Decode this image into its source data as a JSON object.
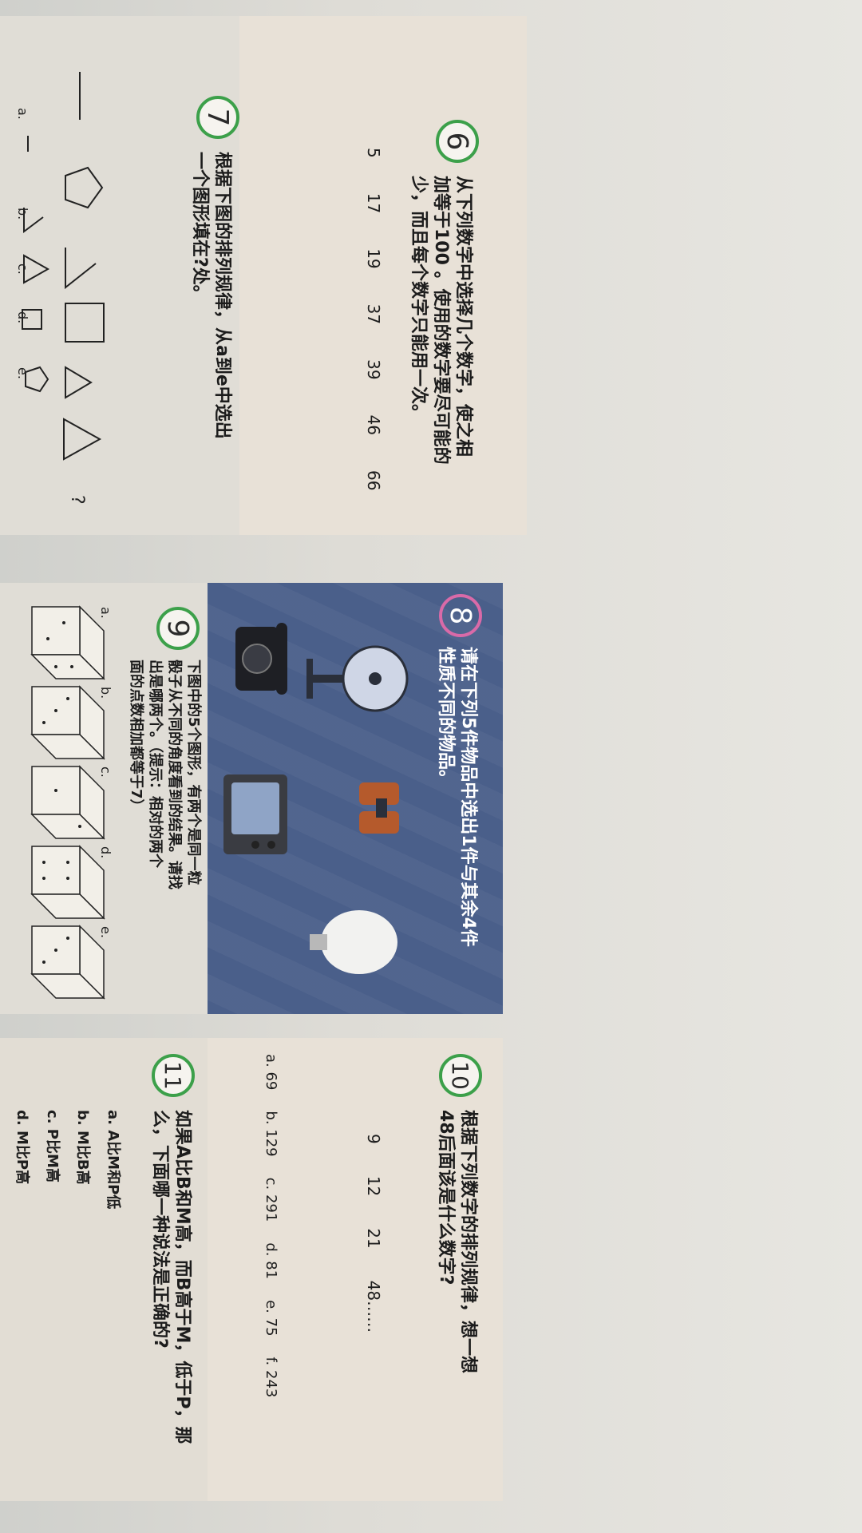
{
  "q6": {
    "num": "6",
    "text_line1": "从下列数字中选择几个数字，使之相",
    "text_line2": "加等于100 。使用的数字要尽可能的",
    "text_line3": "少，而且每个数字只能用一次。",
    "numbers": [
      "5",
      "17",
      "19",
      "37",
      "39",
      "46",
      "66"
    ]
  },
  "q7": {
    "num": "7",
    "text_line1": "根据下图的排列规律，从a到e中选出",
    "text_line2": "一个图形填在?处。",
    "question_mark": "?",
    "options": [
      "a.",
      "b.",
      "c.",
      "d.",
      "e."
    ]
  },
  "q8": {
    "num": "8",
    "text_line1": "请在下列5件物品中选出1件与其余4件",
    "text_line2": "性质不同的物品。"
  },
  "q9": {
    "num": "9",
    "text_line1": "下图中的5个图形，有两个是同一粒",
    "text_line2": "骰子从不同的角度看到的结果。请找",
    "text_line3": "出是哪两个。（提示：相对的两个",
    "text_line4": "面的点数相加都等于7）",
    "options": [
      "a.",
      "b.",
      "c.",
      "d.",
      "e."
    ]
  },
  "q10": {
    "num": "10",
    "text_line1": "根据下列数字的排列规律，想一想",
    "text_line2": "48后面该是什么数字?",
    "sequence": [
      "9",
      "12",
      "21",
      "48……"
    ],
    "options": [
      "a. 69",
      "b. 129",
      "c. 291",
      "d. 81",
      "e. 75",
      "f. 243"
    ]
  },
  "q11": {
    "num": "11",
    "text_line1": "如果A比B和M高，而B高于M，低于P，那",
    "text_line2": "么，下面哪一种说法是正确的?",
    "options": [
      "a.   A比M和P低",
      "b.   M比B高",
      "c.   P比M高",
      "d.   M比P高"
    ]
  },
  "colors": {
    "panel": "#e8e1d7",
    "blue_panel": "#4a5f8a",
    "green_circle": "#3ca04a",
    "pink_circle": "#d96aa8"
  }
}
